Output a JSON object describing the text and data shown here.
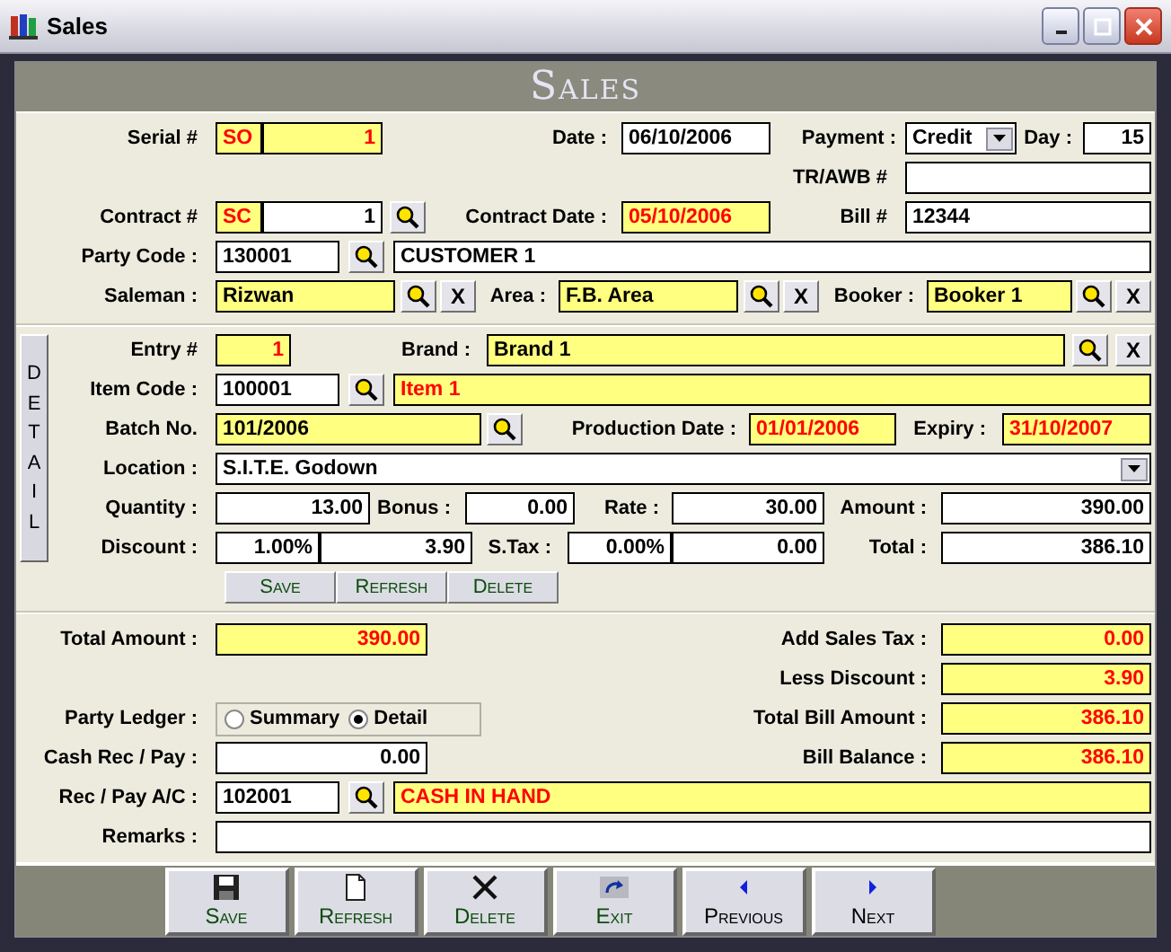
{
  "window": {
    "title": "Sales"
  },
  "header": {
    "title": "Sales"
  },
  "main": {
    "rows": [
      {
        "items": [
          {
            "kind": "label",
            "text": "Serial #"
          },
          {
            "kind": "field",
            "value": "SO",
            "highlighted": true,
            "alert": true
          },
          {
            "kind": "field",
            "value": "1",
            "highlighted": true,
            "alert": true
          },
          {
            "kind": "label",
            "text": "Date :"
          },
          {
            "kind": "field",
            "value": "06/10/2006",
            "highlighted": false,
            "alert": false
          },
          {
            "kind": "label",
            "text": "Payment :"
          },
          {
            "kind": "dropdown",
            "value": "Credit"
          },
          {
            "kind": "label",
            "text": "Day :"
          },
          {
            "kind": "field",
            "value": "15",
            "highlighted": false,
            "alert": false
          }
        ]
      },
      {
        "items": [
          {
            "kind": "label",
            "text": "TR/AWB #"
          },
          {
            "kind": "field",
            "highlighted": false
          }
        ]
      },
      {
        "items": [
          {
            "kind": "label",
            "text": "Contract #"
          },
          {
            "kind": "field",
            "value": "SC",
            "highlighted": true,
            "alert": true
          },
          {
            "kind": "field",
            "value": "1",
            "highlighted": false,
            "alert": false
          },
          {
            "kind": "lookup"
          },
          {
            "kind": "label",
            "text": "Contract Date :"
          },
          {
            "kind": "field",
            "value": "05/10/2006",
            "highlighted": true,
            "alert": true
          },
          {
            "kind": "label",
            "text": "Bill #"
          },
          {
            "kind": "field",
            "value": "12344",
            "highlighted": false,
            "alert": false
          }
        ]
      },
      {
        "items": [
          {
            "kind": "label",
            "text": "Party Code :"
          },
          {
            "kind": "field",
            "value": "130001",
            "highlighted": false,
            "alert": false
          },
          {
            "kind": "lookup"
          },
          {
            "kind": "field",
            "value": "CUSTOMER 1",
            "highlighted": false,
            "alert": false
          }
        ]
      },
      {
        "items": [
          {
            "kind": "label",
            "text": "Saleman :"
          },
          {
            "kind": "field",
            "value": "Rizwan",
            "highlighted": true,
            "alert": false
          },
          {
            "kind": "lookup"
          },
          {
            "kind": "clear",
            "text": "X"
          },
          {
            "kind": "label",
            "text": "Area :"
          },
          {
            "kind": "field",
            "value": "F.B. Area",
            "highlighted": true,
            "alert": false
          },
          {
            "kind": "lookup"
          },
          {
            "kind": "clear",
            "text": "X"
          },
          {
            "kind": "label",
            "text": "Booker :"
          },
          {
            "kind": "field",
            "value": "Booker 1",
            "highlighted": true,
            "alert": false
          },
          {
            "kind": "lookup"
          },
          {
            "kind": "clear",
            "text": "X"
          }
        ]
      }
    ]
  },
  "detail": {
    "tab": "DETAIL",
    "rows": [
      {
        "items": [
          {
            "kind": "label",
            "text": "Entry #"
          },
          {
            "kind": "field",
            "value": "1",
            "highlighted": true,
            "alert": true
          },
          {
            "kind": "label",
            "text": "Brand :"
          },
          {
            "kind": "field",
            "value": "Brand 1",
            "highlighted": true,
            "alert": false
          },
          {
            "kind": "lookup"
          },
          {
            "kind": "clear",
            "text": "X"
          }
        ]
      },
      {
        "items": [
          {
            "kind": "label",
            "text": "Item Code :"
          },
          {
            "kind": "field",
            "value": "100001",
            "highlighted": false,
            "alert": false
          },
          {
            "kind": "lookup"
          },
          {
            "kind": "field",
            "value": "Item 1",
            "highlighted": true,
            "alert": true
          }
        ]
      },
      {
        "items": [
          {
            "kind": "label",
            "text": "Batch No."
          },
          {
            "kind": "field",
            "value": "101/2006",
            "highlighted": true,
            "alert": false
          },
          {
            "kind": "lookup"
          },
          {
            "kind": "label",
            "text": "Production Date :"
          },
          {
            "kind": "field",
            "value": "01/01/2006",
            "highlighted": true,
            "alert": true
          },
          {
            "kind": "label",
            "text": "Expiry :"
          },
          {
            "kind": "field",
            "value": "31/10/2007",
            "highlighted": true,
            "alert": true
          }
        ]
      },
      {
        "items": [
          {
            "kind": "label",
            "text": "Location :"
          },
          {
            "kind": "dropdown",
            "value": "S.I.T.E. Godown"
          }
        ]
      },
      {
        "items": [
          {
            "kind": "label",
            "text": "Quantity :"
          },
          {
            "kind": "field",
            "value": "13.00",
            "highlighted": false,
            "alert": false
          },
          {
            "kind": "label",
            "text": "Bonus :"
          },
          {
            "kind": "field",
            "value": "0.00",
            "highlighted": false,
            "alert": false
          },
          {
            "kind": "label",
            "text": "Rate :"
          },
          {
            "kind": "field",
            "value": "30.00",
            "highlighted": false,
            "alert": false
          },
          {
            "kind": "label",
            "text": "Amount :"
          },
          {
            "kind": "field",
            "value": "390.00",
            "highlighted": false,
            "alert": false
          }
        ]
      },
      {
        "items": [
          {
            "kind": "label",
            "text": "Discount :"
          },
          {
            "kind": "field",
            "value": "1.00%",
            "highlighted": false,
            "alert": false
          },
          {
            "kind": "field",
            "value": "3.90",
            "highlighted": false,
            "alert": false
          },
          {
            "kind": "label",
            "text": "S.Tax :"
          },
          {
            "kind": "field",
            "value": "0.00%",
            "highlighted": false,
            "alert": false
          },
          {
            "kind": "field",
            "value": "0.00",
            "highlighted": false,
            "alert": false
          },
          {
            "kind": "label",
            "text": "Total :"
          },
          {
            "kind": "field",
            "value": "386.10",
            "highlighted": false,
            "alert": false
          }
        ]
      }
    ],
    "buttons": [
      "Save",
      "Refresh",
      "Delete"
    ]
  },
  "totals": {
    "rows": [
      {
        "items": [
          {
            "kind": "label",
            "text": "Total Amount :"
          },
          {
            "kind": "field",
            "value": "390.00",
            "highlighted": true,
            "alert": true
          },
          {
            "kind": "label",
            "text": "Add Sales Tax :"
          },
          {
            "kind": "field",
            "value": "0.00",
            "highlighted": true,
            "alert": true
          }
        ]
      },
      {
        "items": [
          {
            "kind": "label",
            "text": "Less Discount :"
          },
          {
            "kind": "field",
            "value": "3.90",
            "highlighted": true,
            "alert": true
          }
        ]
      },
      {
        "items": [
          {
            "kind": "label",
            "text": "Party Ledger :"
          },
          {
            "kind": "radio",
            "options": [
              {
                "label": "Summary",
                "selected": false
              },
              {
                "label": "Detail",
                "selected": true
              }
            ]
          },
          {
            "kind": "label",
            "text": "Total Bill Amount :"
          },
          {
            "kind": "field",
            "value": "386.10",
            "highlighted": true,
            "alert": true
          }
        ]
      },
      {
        "items": [
          {
            "kind": "label",
            "text": "Cash Rec / Pay :"
          },
          {
            "kind": "field",
            "value": "0.00",
            "highlighted": false,
            "alert": false
          },
          {
            "kind": "label",
            "text": "Bill Balance :"
          },
          {
            "kind": "field",
            "value": "386.10",
            "highlighted": true,
            "alert": true
          }
        ]
      },
      {
        "items": [
          {
            "kind": "label",
            "text": "Rec / Pay A/C :"
          },
          {
            "kind": "field",
            "value": "102001",
            "highlighted": false,
            "alert": false
          },
          {
            "kind": "lookup"
          },
          {
            "kind": "field",
            "value": "CASH IN HAND",
            "highlighted": true,
            "alert": true
          }
        ]
      },
      {
        "items": [
          {
            "kind": "label",
            "text": "Remarks :"
          },
          {
            "kind": "field",
            "highlighted": false
          }
        ]
      }
    ]
  },
  "toolbar": {
    "buttons": [
      {
        "label": "Save",
        "kind": "save"
      },
      {
        "label": "Refresh",
        "kind": "new"
      },
      {
        "label": "Delete",
        "kind": "delete"
      },
      {
        "label": "Exit",
        "kind": "exit"
      },
      {
        "label": "Previous",
        "kind": "previous"
      },
      {
        "label": "Next",
        "kind": "next"
      }
    ]
  }
}
